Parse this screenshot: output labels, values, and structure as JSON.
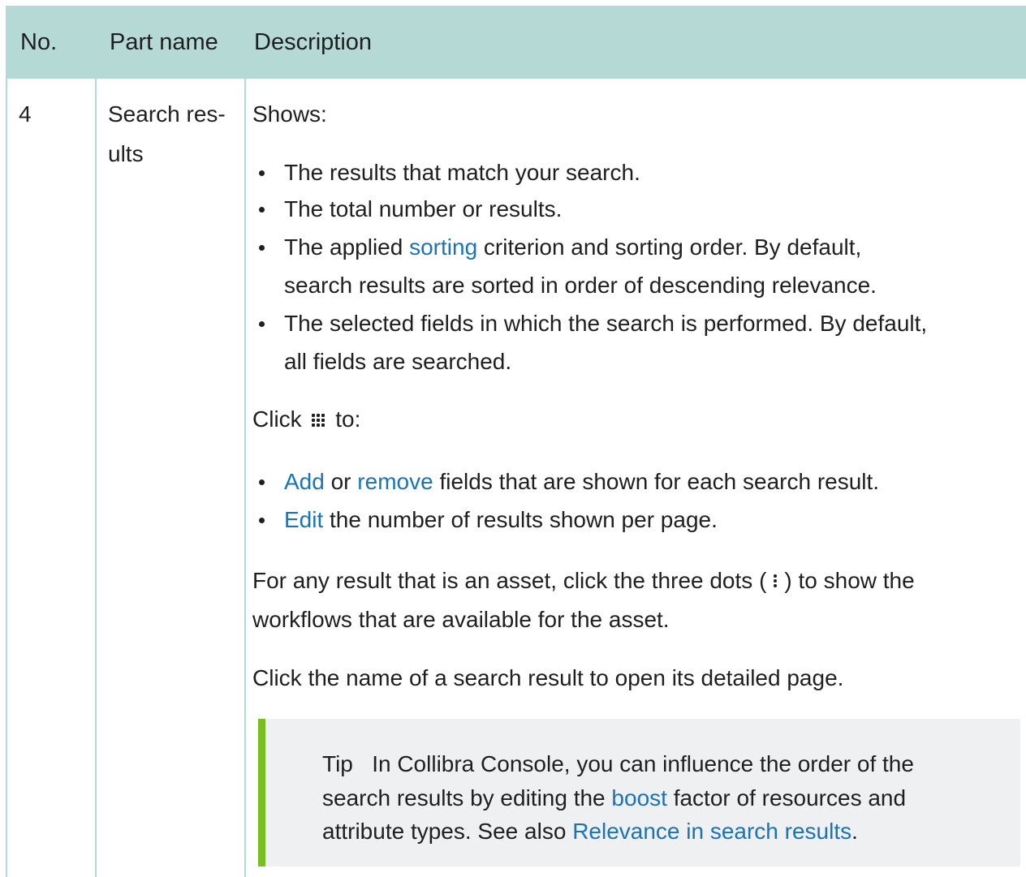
{
  "table": {
    "headers": {
      "no": "No.",
      "part_name": "Part name",
      "description": "Description"
    },
    "row": {
      "no": "4",
      "part_name_line1": "Search res-",
      "part_name_line2": "ults",
      "shows_label": "Shows:",
      "bullets1": {
        "b1": "The results that match your search.",
        "b2": "The total number or results.",
        "b3_pre": "The applied ",
        "b3_link": "sorting",
        "b3_post": " criterion and sorting order. By default,",
        "b3_line2": "search results are sorted in order of descending relevance.",
        "b4_line1": "The selected fields in which the search is performed. By default,",
        "b4_line2": "all fields are searched."
      },
      "click_pre": "Click",
      "click_icon": "grid-icon",
      "click_post": "to:",
      "bullets2": {
        "b1_link1": "Add",
        "b1_mid": " or ",
        "b1_link2": "remove",
        "b1_post": " fields that are shown for each search result.",
        "b2_link": "Edit",
        "b2_post": " the number of results shown per page."
      },
      "asset_line1_pre": "For any result that is an asset, click the three dots (",
      "asset_icon": "more-vertical-icon",
      "asset_line1_post": ") to show the",
      "asset_line2": "workflows that are available for the asset.",
      "click_name": "Click the name of a search result to open its detailed page.",
      "tip": {
        "label": "Tip",
        "line1": "In Collibra Console, you can influence the order of the",
        "line2_pre": "search results by editing the ",
        "line2_link": "boost",
        "line2_post": " factor of resources and",
        "line3_pre": "attribute types. See also ",
        "line3_link": "Relevance in search results",
        "line3_post": "."
      }
    }
  },
  "colors": {
    "header_bg": "#b5dad6",
    "link": "#1a73b7",
    "tip_bg": "#eef0f1",
    "tip_bar": "#78be20"
  }
}
